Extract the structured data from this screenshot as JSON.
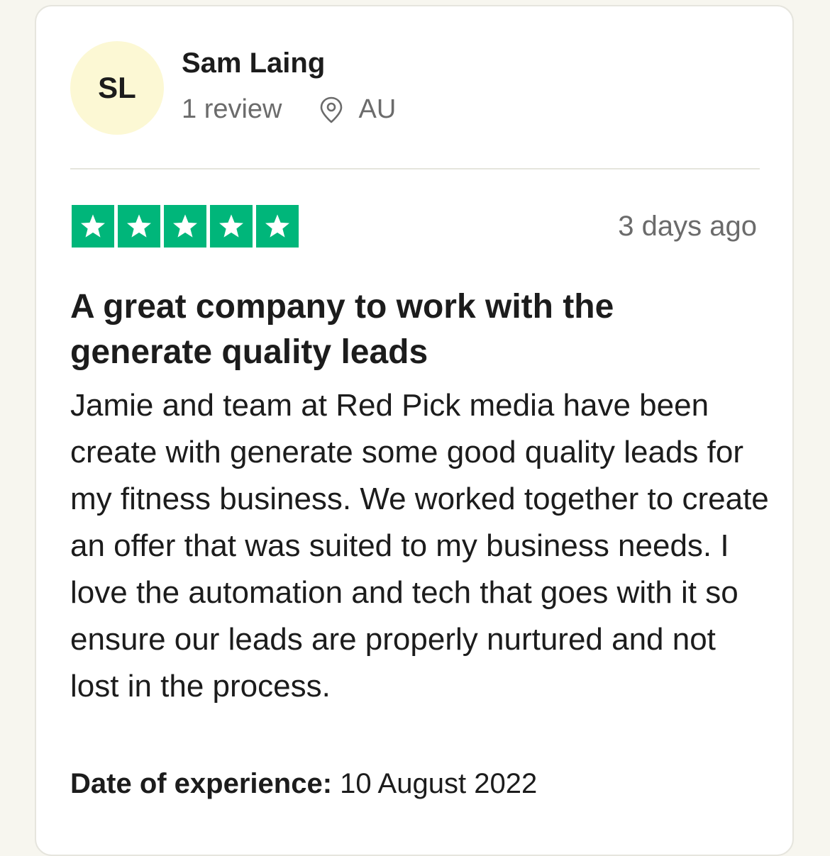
{
  "consumer": {
    "initials": "SL",
    "name": "Sam Laing",
    "review_count": "1 review",
    "location": "AU",
    "avatar_color": "#fcf8d4"
  },
  "review": {
    "rating": 5,
    "rating_max": 5,
    "star_color": "#00b67a",
    "date_ago": "3 days ago",
    "title": "A great company to work with the generate quality leads",
    "body": "Jamie and team at Red Pick media have been create with generate some good quality leads for my fitness business. We worked together to create an offer that was suited to my business needs. I love the automation and tech that goes with it so ensure our leads are properly nurtured and not lost in the process.",
    "experience_label": "Date of experience:",
    "experience_date": "10 August 2022"
  },
  "icons": {
    "location": "location-pin-icon",
    "star": "star-icon"
  }
}
